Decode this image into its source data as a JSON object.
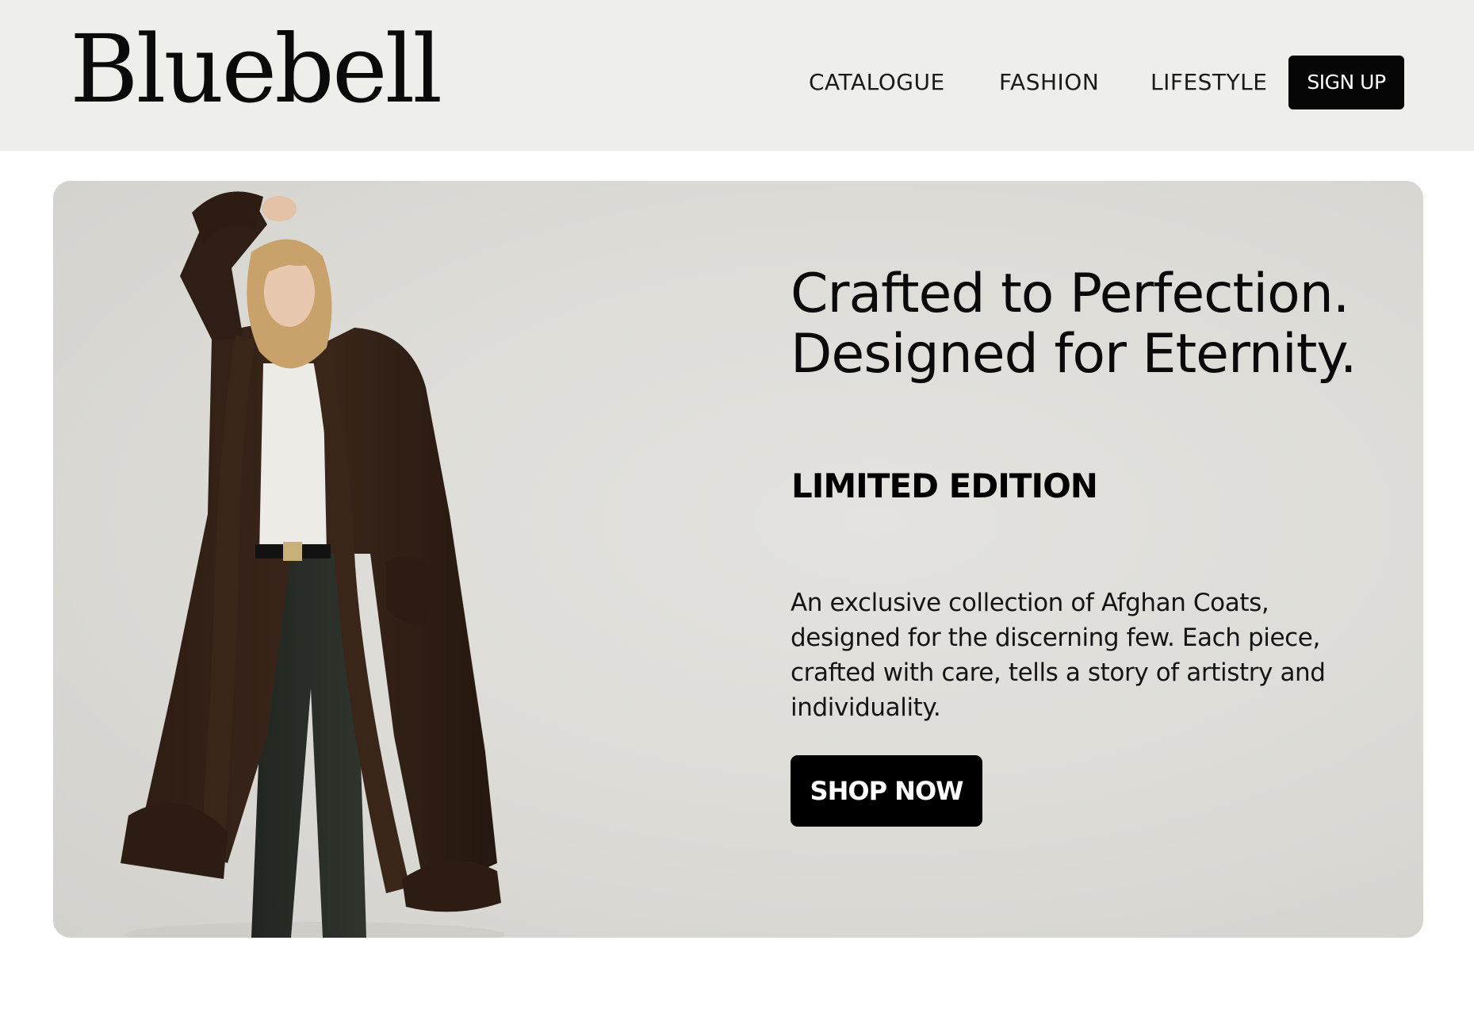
{
  "header": {
    "logo": "Bluebell",
    "nav": [
      {
        "label": "CATALOGUE"
      },
      {
        "label": "FASHION"
      },
      {
        "label": "LIFESTYLE"
      }
    ],
    "signup_label": "SIGN UP"
  },
  "hero": {
    "headline_line1": "Crafted to  Perfection.",
    "headline_line2": "Designed for  Eternity.",
    "edition": "LIMITED EDITION",
    "description": "An exclusive collection of Afghan Coats, designed for the discerning few.  Each piece, crafted with care, tells a story of artistry and individuality.",
    "cta_label": "SHOP NOW"
  },
  "colors": {
    "header_bg": "#eeeeea",
    "hero_bg": "#dcdbd6",
    "button_bg": "#000000",
    "button_text": "#ffffff"
  }
}
